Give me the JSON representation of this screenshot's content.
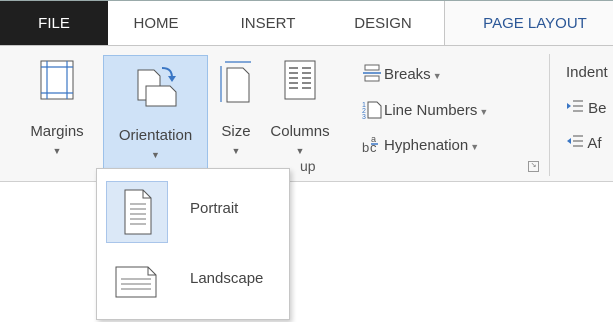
{
  "tabs": {
    "file": "FILE",
    "home": "HOME",
    "insert": "INSERT",
    "design": "DESIGN",
    "page_layout": "PAGE LAYOUT"
  },
  "ribbon": {
    "margins": "Margins",
    "orientation": "Orientation",
    "size": "Size",
    "columns": "Columns",
    "breaks": "Breaks",
    "line_numbers": "Line Numbers",
    "hyphenation": "Hyphenation",
    "group_label_visible": "up",
    "indent_title": "Indent",
    "indent_before": "Be",
    "indent_after": "Af"
  },
  "orientation_menu": {
    "portrait": "Portrait",
    "landscape": "Landscape"
  },
  "colors": {
    "accent": "#2b5797",
    "hover_bg": "#cfe2f7",
    "file_tab": "#1f1f1f"
  }
}
